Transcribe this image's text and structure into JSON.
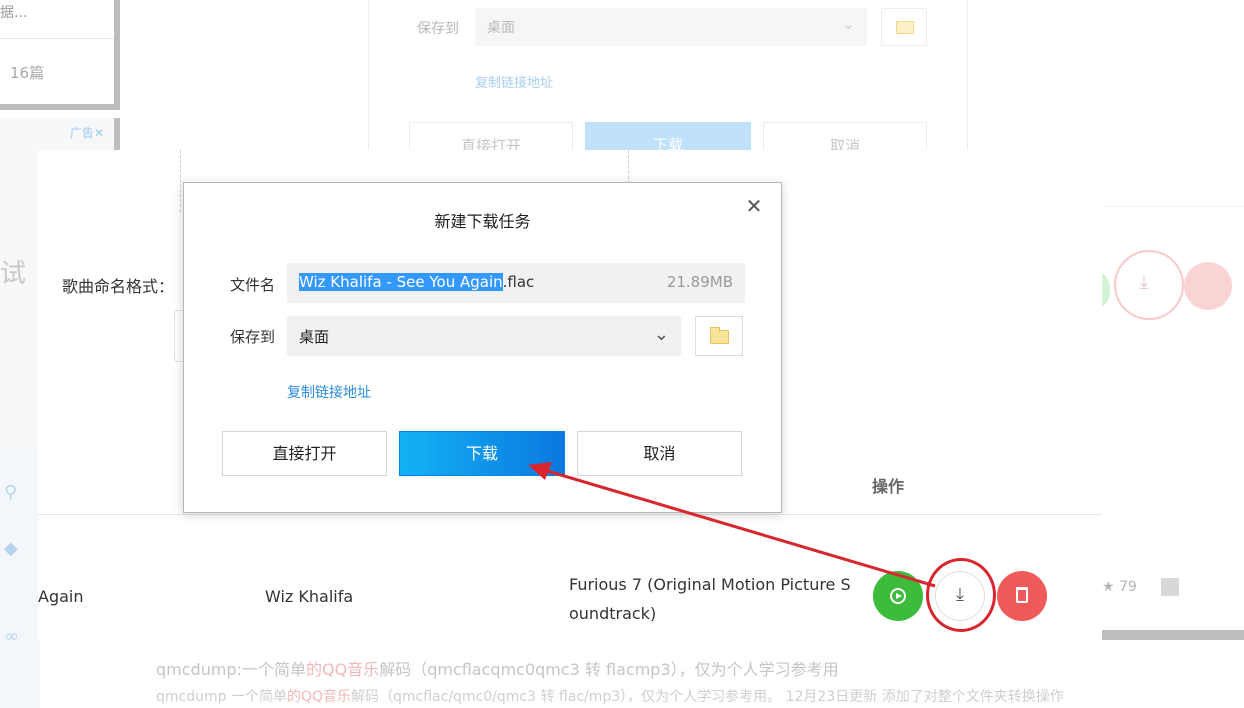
{
  "background": {
    "left_card_text": "据...",
    "left_card_count": "16篇",
    "ad_label": "广告",
    "ad_close": "✕",
    "ad_big_text": "试",
    "top_dialog": {
      "save_label": "保存到",
      "save_value": "桌面",
      "copy_link": "复制链接地址",
      "open_label": "直接打开",
      "download_label": "下载",
      "cancel_label": "取消"
    },
    "star_count": "79",
    "article_line_1_a": "qmcdump:一个简单",
    "article_line_1_red": "的QQ音乐",
    "article_line_1_b": "解码（qmcflacqmc0qmc3 转 flacmp3），仅为个人学习参考用",
    "article_line_2_a": "qmcdump 一个简单",
    "article_line_2_red": "的QQ音乐",
    "article_line_2_b": "解码（qmcflac/qmc0/qmc3 转 flac/mp3），仅为个人学习参考用。 12月23日更新 添加了对整个文件夹转换操作"
  },
  "panel": {
    "name_format_label": "歌曲命名格式：",
    "ops_header": "操作",
    "row": {
      "title": "Again",
      "artist": "Wiz Khalifa",
      "album": "Furious 7 (Original Motion Picture Soundtrack)"
    }
  },
  "dialog": {
    "title": "新建下载任务",
    "close_glyph": "✕",
    "filename_label": "文件名",
    "filename_selected": "Wiz Khalifa - See You Again",
    "filename_ext": ".flac",
    "filesize": "21.89MB",
    "save_label": "保存到",
    "save_value": "桌面",
    "copy_link": "复制链接地址",
    "open_button": "直接打开",
    "download_button": "下载",
    "cancel_button": "取消"
  },
  "colors": {
    "accent_blue": "#0a84e4",
    "play_green": "#3dbb3d",
    "delete_red": "#f05a5a",
    "annotation_red": "#d9262e"
  }
}
